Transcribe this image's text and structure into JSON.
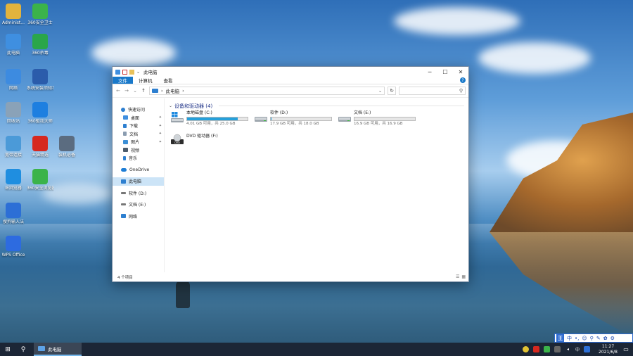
{
  "desktop": {
    "icons": [
      {
        "label": "Administ...",
        "icon": "user-folder-icon",
        "color": "#e2b33d"
      },
      {
        "label": "360安全卫士",
        "icon": "360-safe-icon",
        "color": "#3bb34a"
      },
      {
        "label": "此电脑",
        "icon": "computer-icon",
        "color": "#3f8fe0"
      },
      {
        "label": "360杀毒",
        "icon": "360-antivirus-icon",
        "color": "#2aa64a"
      },
      {
        "label": "网络",
        "icon": "network-icon",
        "color": "#3d8be0"
      },
      {
        "label": "系统安装须知事项.docx",
        "icon": "word-document-icon",
        "color": "#2b5cab"
      },
      {
        "label": "回收站",
        "icon": "recycle-bin-icon",
        "color": "#8aa2b8"
      },
      {
        "label": "360驱动大师",
        "icon": "360-driver-icon",
        "color": "#1e7fe0"
      },
      {
        "label": "宽带连接",
        "icon": "broadband-icon",
        "color": "#4b9ad8"
      },
      {
        "label": "天猫精选",
        "icon": "tmall-icon",
        "color": "#d6281f"
      },
      {
        "label": "装机必备",
        "icon": "install-tools-icon",
        "color": "#5b6c80"
      },
      {
        "label": "IE浏览器",
        "icon": "ie-browser-icon",
        "color": "#1f8ee0"
      },
      {
        "label": "360安全浏览器",
        "icon": "360-browser-icon",
        "color": "#3bb34a"
      },
      {
        "label": "搜狗输入法",
        "icon": "sogou-icon",
        "color": "#2c6fd6"
      },
      {
        "label": "WPS Office",
        "icon": "wps-icon",
        "color": "#2d6be0"
      }
    ]
  },
  "window": {
    "title": "此电脑",
    "controls": {
      "minimize": "─",
      "maximize": "☐",
      "close": "✕"
    },
    "ribbon_tabs": [
      "文件",
      "计算机",
      "查看"
    ],
    "help_label": "?",
    "address": {
      "path_item": "此电脑",
      "separator": "›",
      "back": "←",
      "forward": "→",
      "up": "↑",
      "dropdown": "⌄",
      "refresh": "↻",
      "search_icon": "⚲"
    },
    "nav_pane": {
      "quick_access": "快速访问",
      "quick_items": [
        "桌面",
        "下载",
        "文档",
        "图片",
        "视频",
        "音乐"
      ],
      "onedrive": "OneDrive",
      "this_pc": "此电脑",
      "drive_d": "软件 (D:)",
      "drive_e": "文档 (E:)",
      "network": "网络"
    },
    "group_header": "设备和驱动器 (4)",
    "drives": [
      {
        "name": "本地磁盘 (C:)",
        "size": "4.01 GB 可用，共 25.0 GB",
        "used_fraction": 0.84
      },
      {
        "name": "软件 (D:)",
        "size": "17.9 GB 可用，共 18.0 GB",
        "used_fraction": 0.01
      },
      {
        "name": "文档 (E:)",
        "size": "16.9 GB 可用，共 16.9 GB",
        "used_fraction": 0.0
      },
      {
        "name": "DVD 驱动器 (F:)",
        "size": "",
        "used_fraction": null
      }
    ],
    "status": "4 个项目",
    "accent_color": "#1979ca",
    "bar_color": "#26a0da"
  },
  "taskbar": {
    "start": "⊞",
    "search": "⚲",
    "active_app": "此电脑",
    "ime": {
      "logo": "王",
      "mode": "中"
    },
    "tray_lang": "中",
    "time": "11:27",
    "date": "2021/6/8",
    "notification": "▭"
  }
}
